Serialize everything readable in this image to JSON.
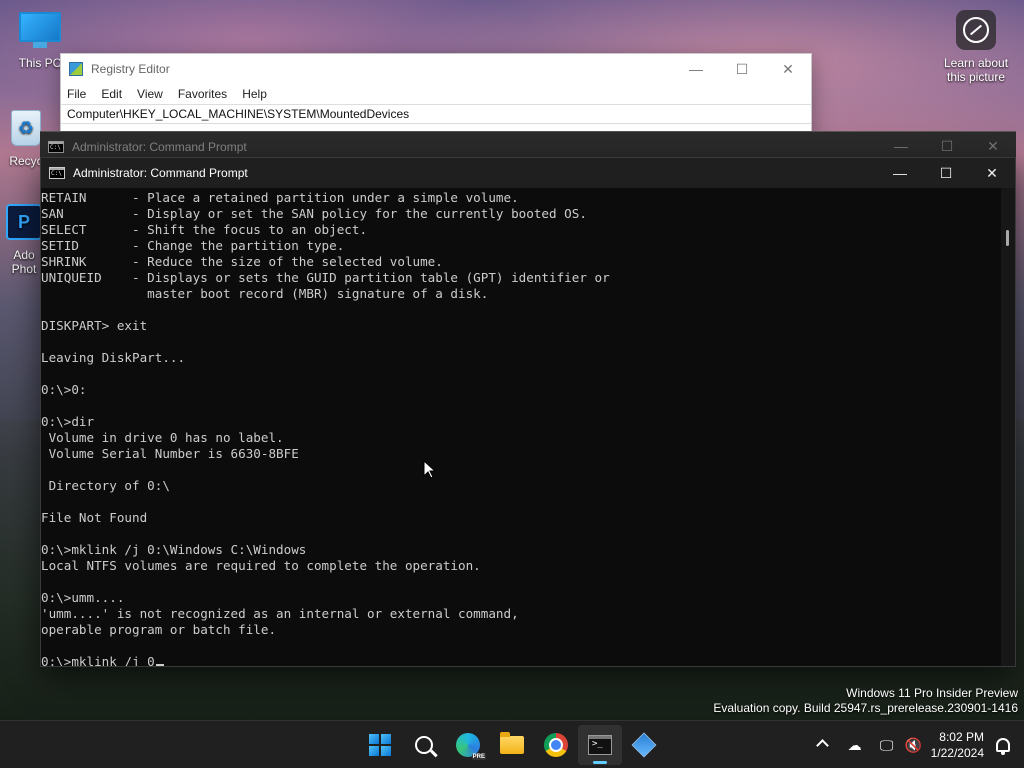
{
  "desktop": {
    "icons": [
      {
        "label": "This PC",
        "icon": "monitor-icon"
      },
      {
        "label": "Recyc",
        "icon": "recycle-bin-icon"
      },
      {
        "label": "Ado",
        "label2": "Phot",
        "icon": "photoshop-icon"
      }
    ],
    "learn_picture": {
      "line1": "Learn about",
      "line2": "this picture",
      "icon": "camera-icon"
    }
  },
  "registry_editor": {
    "title": "Registry Editor",
    "menu": [
      "File",
      "Edit",
      "View",
      "Favorites",
      "Help"
    ],
    "address": "Computer\\HKEY_LOCAL_MACHINE\\SYSTEM\\MountedDevices"
  },
  "cmd_back": {
    "title": "Administrator: Command Prompt"
  },
  "cmd": {
    "title": "Administrator: Command Prompt",
    "lines": [
      "RETAIN      - Place a retained partition under a simple volume.",
      "SAN         - Display or set the SAN policy for the currently booted OS.",
      "SELECT      - Shift the focus to an object.",
      "SETID       - Change the partition type.",
      "SHRINK      - Reduce the size of the selected volume.",
      "UNIQUEID    - Displays or sets the GUID partition table (GPT) identifier or",
      "              master boot record (MBR) signature of a disk.",
      "",
      "DISKPART> exit",
      "",
      "Leaving DiskPart...",
      "",
      "0:\\>0:",
      "",
      "0:\\>dir",
      " Volume in drive 0 has no label.",
      " Volume Serial Number is 6630-8BFE",
      "",
      " Directory of 0:\\",
      "",
      "File Not Found",
      "",
      "0:\\>mklink /j 0:\\Windows C:\\Windows",
      "Local NTFS volumes are required to complete the operation.",
      "",
      "0:\\>umm....",
      "'umm....' is not recognized as an internal or external command,",
      "operable program or batch file.",
      ""
    ],
    "prompt_line": "0:\\>mklink /j 0"
  },
  "watermark": {
    "line1": "Windows 11 Pro Insider Preview",
    "line2": "Evaluation copy. Build 25947.rs_prerelease.230901-1416"
  },
  "taskbar": {
    "apps": [
      {
        "name": "start",
        "icon": "windows-logo-icon"
      },
      {
        "name": "search",
        "icon": "search-icon"
      },
      {
        "name": "edge-beta",
        "icon": "edge-icon",
        "badge": "PRE"
      },
      {
        "name": "file-explorer",
        "icon": "folder-icon"
      },
      {
        "name": "chrome",
        "icon": "chrome-icon"
      },
      {
        "name": "command-prompt",
        "icon": "terminal-icon",
        "active": true
      },
      {
        "name": "registry-editor",
        "icon": "registry-icon"
      }
    ],
    "tray": {
      "time": "8:02 PM",
      "date": "1/22/2024"
    }
  },
  "colors": {
    "console_bg": "#0c0c0c",
    "console_fg": "#cccccc",
    "taskbar_bg": "#202020",
    "active_indicator": "#60cdff"
  }
}
